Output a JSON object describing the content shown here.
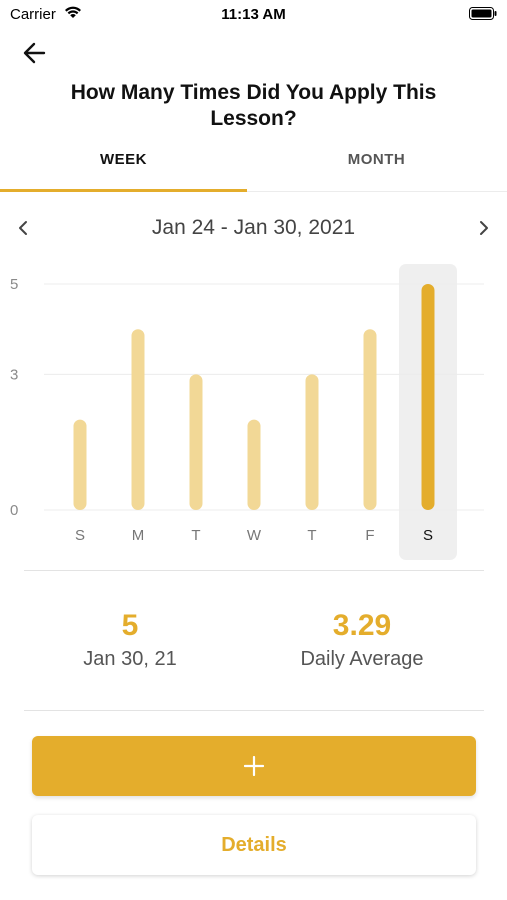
{
  "status_bar": {
    "carrier": "Carrier",
    "time": "11:13 AM"
  },
  "header": {
    "title": "How Many Times Did You Apply This Lesson?"
  },
  "tabs": [
    {
      "label": "WEEK",
      "selected": true
    },
    {
      "label": "MONTH",
      "selected": false
    }
  ],
  "date_nav": {
    "range": "Jan 24 - Jan 30, 2021"
  },
  "chart_data": {
    "type": "bar",
    "categories": [
      "S",
      "M",
      "T",
      "W",
      "T",
      "F",
      "S"
    ],
    "values": [
      2,
      4,
      3,
      2,
      3,
      4,
      5
    ],
    "y_ticks": [
      "0",
      "3",
      "5"
    ],
    "ylim": [
      0,
      5
    ],
    "selected_index": 6,
    "bar_color": "#f2d896",
    "selected_bar_color": "#e4ad2c",
    "selected_background": "#efefef"
  },
  "stats": {
    "selected_value": "5",
    "selected_date": "Jan 30, 21",
    "average_value": "3.29",
    "average_label": "Daily Average"
  },
  "actions": {
    "add_icon": "plus-icon",
    "details_label": "Details"
  },
  "colors": {
    "accent": "#e4ad2c"
  }
}
